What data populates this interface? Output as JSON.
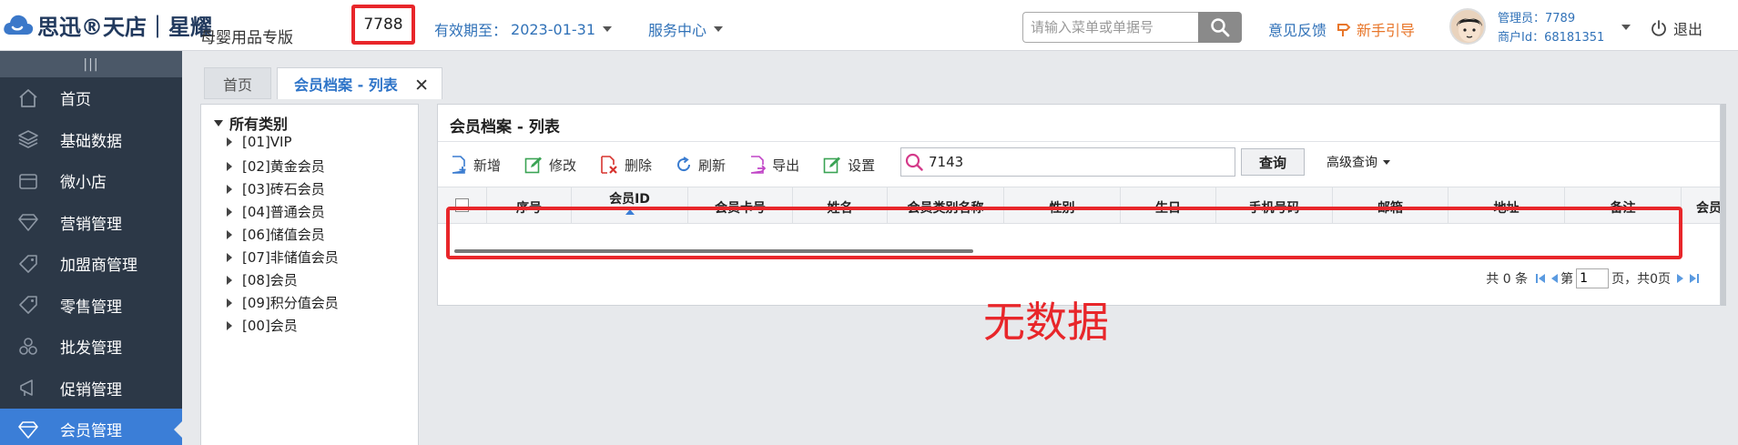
{
  "header": {
    "logo_text": "思迅®天店｜星耀",
    "edition": "母婴用品专版",
    "code": "7788",
    "validity_label": "有效期至：",
    "validity_date": "2023-01-31",
    "service_center": "服务中心",
    "search_placeholder": "请输入菜单或单据号",
    "feedback": "意见反馈",
    "guide": "新手引导",
    "admin_label": "管理员：7789",
    "merchant_label": "商户Id：68181351",
    "logout": "退出"
  },
  "sidebar": {
    "handle": "|||",
    "items": [
      {
        "label": "首页",
        "icon": "home-icon"
      },
      {
        "label": "基础数据",
        "icon": "layers-icon"
      },
      {
        "label": "微小店",
        "icon": "store-icon"
      },
      {
        "label": "营销管理",
        "icon": "diamond-icon"
      },
      {
        "label": "加盟商管理",
        "icon": "tag-icon"
      },
      {
        "label": "零售管理",
        "icon": "tag-icon"
      },
      {
        "label": "批发管理",
        "icon": "boxes-icon"
      },
      {
        "label": "促销管理",
        "icon": "megaphone-icon"
      },
      {
        "label": "会员管理",
        "icon": "diamond-icon"
      }
    ],
    "active_index": 8
  },
  "tabs": {
    "home": "首页",
    "active": "会员档案 - 列表",
    "close": "✕"
  },
  "tree": {
    "root": "所有类别",
    "items": [
      "[01]VIP",
      "[02]黄金会员",
      "[03]砖石会员",
      "[04]普通会员",
      "[06]储值会员",
      "[07]非储值会员",
      "[08]会员",
      "[09]积分值会员",
      "[00]会员"
    ]
  },
  "panel": {
    "title": "会员档案 - 列表",
    "toolbar": {
      "add": "新增",
      "edit": "修改",
      "delete": "删除",
      "refresh": "刷新",
      "export": "导出",
      "settings": "设置"
    },
    "filter_value": "7143",
    "query": "查询",
    "advanced": "高级查询",
    "columns": [
      "序号",
      "会员ID",
      "会员卡号",
      "姓名",
      "会员类别名称",
      "性别",
      "生日",
      "手机号码",
      "邮箱",
      "地址",
      "备注",
      "会员"
    ],
    "pager": {
      "total": "共 0 条",
      "page_prefix": "第",
      "page_value": "1",
      "page_suffix": "页，共0页"
    }
  },
  "annotation": {
    "no_data": "无数据"
  },
  "colors": {
    "sidebar_bg": "#2c3847",
    "active_nav": "#3b7ed7",
    "link_blue": "#3172b8",
    "guide_orange": "#e8762a",
    "highlight_red": "#e8262a"
  }
}
